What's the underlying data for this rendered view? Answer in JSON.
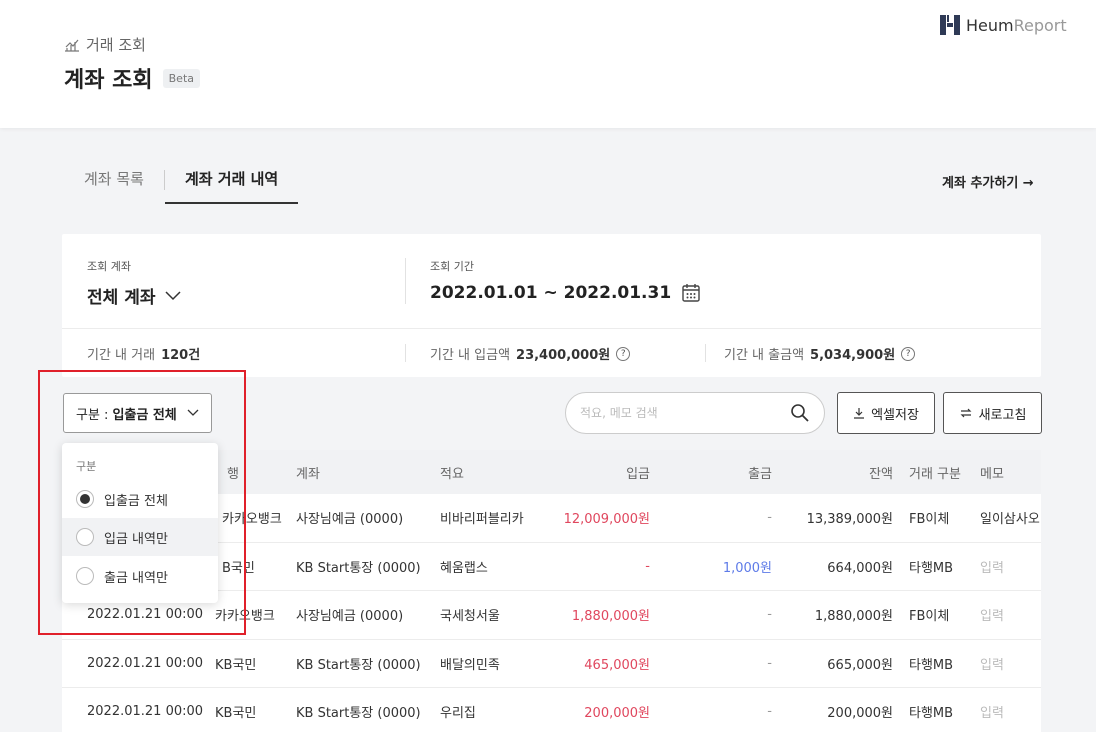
{
  "header": {
    "breadcrumb": "거래 조회",
    "title": "계좌 조회",
    "badge": "Beta",
    "logo_bold": "Heum",
    "logo_light": "Report"
  },
  "tabs": [
    {
      "label": "계좌 목록",
      "active": false
    },
    {
      "label": "계좌 거래 내역",
      "active": true
    }
  ],
  "add_account_label": "계좌 추가하기 →",
  "summary": {
    "account_label": "조회 계좌",
    "account_value": "전체 계좌",
    "period_label": "조회 기간",
    "period_value": "2022.01.01 ~ 2022.01.31",
    "tx_count_label": "기간 내 거래",
    "tx_count_value": "120건",
    "deposit_label": "기간 내 입금액",
    "deposit_value": "23,400,000원",
    "withdraw_label": "기간 내 출금액",
    "withdraw_value": "5,034,900원"
  },
  "toolbar": {
    "filter_prefix": "구분 : ",
    "filter_value": "입출금 전체",
    "search_placeholder": "적요, 메모 검색",
    "excel_label": "엑셀저장",
    "refresh_label": "새로고침"
  },
  "dropdown": {
    "title": "구분",
    "options": [
      {
        "label": "입출금 전체",
        "selected": true
      },
      {
        "label": "입금 내역만",
        "selected": false
      },
      {
        "label": "출금 내역만",
        "selected": false
      }
    ]
  },
  "table": {
    "headers": [
      "은행",
      "계좌",
      "적요",
      "입금",
      "출금",
      "잔액",
      "거래 구분",
      "메모"
    ],
    "header_bank_visible": "행",
    "rows": [
      {
        "datetime": "",
        "bank": "카카오뱅크",
        "account": "사장님예금 (0000)",
        "memo_desc": "비바리퍼블리카",
        "deposit": "12,009,000원",
        "withdraw": "-",
        "balance": "13,389,000원",
        "type": "FB이체",
        "memo": "일이삼사오"
      },
      {
        "datetime": "",
        "bank": "B국민",
        "account": "KB Start통장 (0000)",
        "memo_desc": "혜움랩스",
        "deposit": "-",
        "withdraw": "1,000원",
        "balance": "664,000원",
        "type": "타행MB",
        "memo": "입력"
      },
      {
        "datetime": "2022.01.21  00:00",
        "bank": "카카오뱅크",
        "account": "사장님예금 (0000)",
        "memo_desc": "국세청서울",
        "deposit": "1,880,000원",
        "withdraw": "-",
        "balance": "1,880,000원",
        "type": "FB이체",
        "memo": "입력"
      },
      {
        "datetime": "2022.01.21  00:00",
        "bank": "KB국민",
        "account": "KB Start통장 (0000)",
        "memo_desc": "배달의민족",
        "deposit": "465,000원",
        "withdraw": "-",
        "balance": "665,000원",
        "type": "타행MB",
        "memo": "입력"
      },
      {
        "datetime": "2022.01.21  00:00",
        "bank": "KB국민",
        "account": "KB Start통장 (0000)",
        "memo_desc": "우리집",
        "deposit": "200,000원",
        "withdraw": "-",
        "balance": "200,000원",
        "type": "타행MB",
        "memo": "입력"
      }
    ]
  },
  "colors": {
    "deposit": "#e0475e",
    "withdraw": "#5e7be8",
    "highlight_box": "#e0202a"
  },
  "icons": [
    "chart-icon",
    "logo-mark-icon",
    "chevron-down-icon",
    "calendar-icon",
    "help-icon",
    "search-icon",
    "download-icon",
    "refresh-icon"
  ]
}
